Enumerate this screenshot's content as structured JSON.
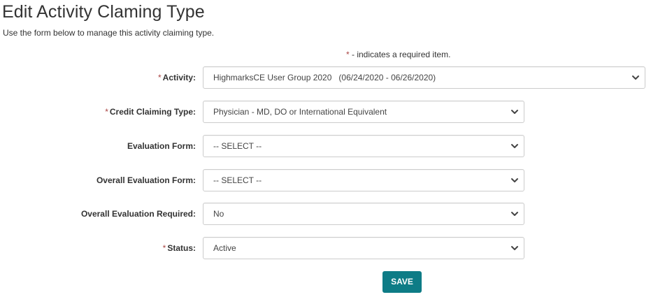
{
  "page": {
    "title": "Edit Activity Claming Type",
    "description": "Use the form below to manage this activity claiming type.",
    "required_star": "*",
    "required_note": " - indicates a required item."
  },
  "form": {
    "activity": {
      "label": "Activity:",
      "required": true,
      "value": "HighmarksCE User Group 2020   (06/24/2020 - 06/26/2020)"
    },
    "credit_claiming_type": {
      "label": "Credit Claiming Type:",
      "required": true,
      "value": "Physician - MD, DO or International Equivalent"
    },
    "evaluation_form": {
      "label": "Evaluation Form:",
      "required": false,
      "value": "-- SELECT --"
    },
    "overall_evaluation_form": {
      "label": "Overall Evaluation Form:",
      "required": false,
      "value": "-- SELECT --"
    },
    "overall_evaluation_required": {
      "label": "Overall Evaluation Required:",
      "required": false,
      "value": "No"
    },
    "status": {
      "label": "Status:",
      "required": true,
      "value": "Active"
    },
    "save_label": "SAVE"
  },
  "colors": {
    "required_star": "#a94442",
    "save_button_bg": "#0e7c86",
    "text": "#333333",
    "border": "#cccccc"
  },
  "icons": {
    "select_chevron": "chevron-down-icon"
  }
}
